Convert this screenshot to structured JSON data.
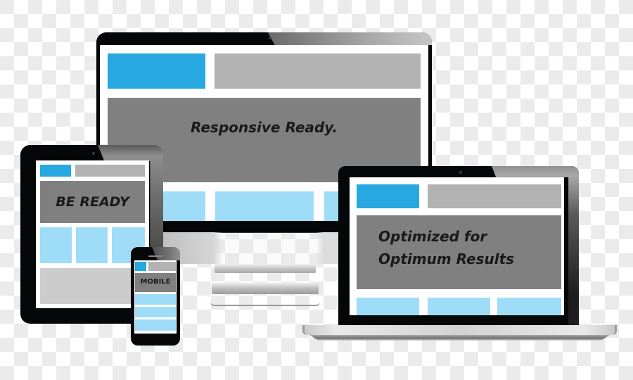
{
  "illustration": {
    "title": "Responsive web design device mockup",
    "colors": {
      "accent_blue": "#27a8e0",
      "light_blue": "#9fdcf8",
      "header_gray": "#b3b3b3",
      "hero_gray": "#808080",
      "footer_gray": "#cccccc",
      "bezel": "#050708",
      "background_checker": "#ebebeb"
    }
  },
  "devices": {
    "monitor": {
      "name": "Desktop monitor",
      "hero_text": "Responsive Ready.",
      "content_blocks": 3
    },
    "tablet": {
      "name": "Tablet",
      "hero_text": "BE READY",
      "content_blocks": 3
    },
    "phone": {
      "name": "Smartphone",
      "hero_text": "MOBILE",
      "content_blocks": 3
    },
    "laptop": {
      "name": "Laptop",
      "hero_text_line1": "Optimized for",
      "hero_text_line2": "Optimum Results",
      "content_blocks": 3
    }
  }
}
